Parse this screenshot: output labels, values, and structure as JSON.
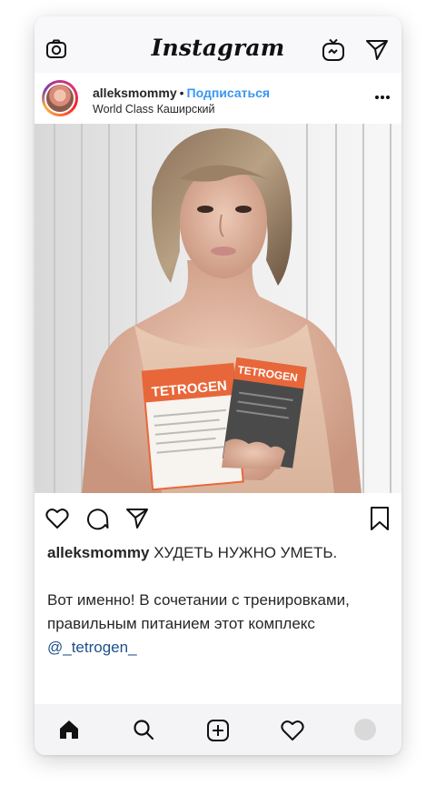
{
  "app": {
    "title": "Instagram"
  },
  "topbar": {
    "icons": [
      "camera-icon",
      "igtv-icon",
      "direct-message-icon"
    ]
  },
  "post": {
    "username": "alleksmommy",
    "separator": "•",
    "follow_label": "Подписаться",
    "location": "World Class Каширский",
    "more_icon": "more-options-icon",
    "image_description_icons": [
      "like-icon",
      "comment-icon",
      "share-icon",
      "save-icon"
    ],
    "product_text": "TETROGEN"
  },
  "caption": {
    "username": "alleksmommy",
    "headline": "ХУДЕТЬ НУЖНО УМЕТЬ.",
    "body": "Вот именно! В сочетании с тренировками, правильным питанием этот комплекс",
    "mention": "@_tetrogen_"
  },
  "bottom_nav": {
    "icons": [
      "home-icon",
      "search-icon",
      "new-post-icon",
      "activity-icon",
      "profile-icon"
    ]
  },
  "colors": {
    "accent": "#3897f0",
    "mention": "#1e4f8a",
    "bar_bg": "#f8f8fa",
    "product_orange": "#e8673a"
  }
}
